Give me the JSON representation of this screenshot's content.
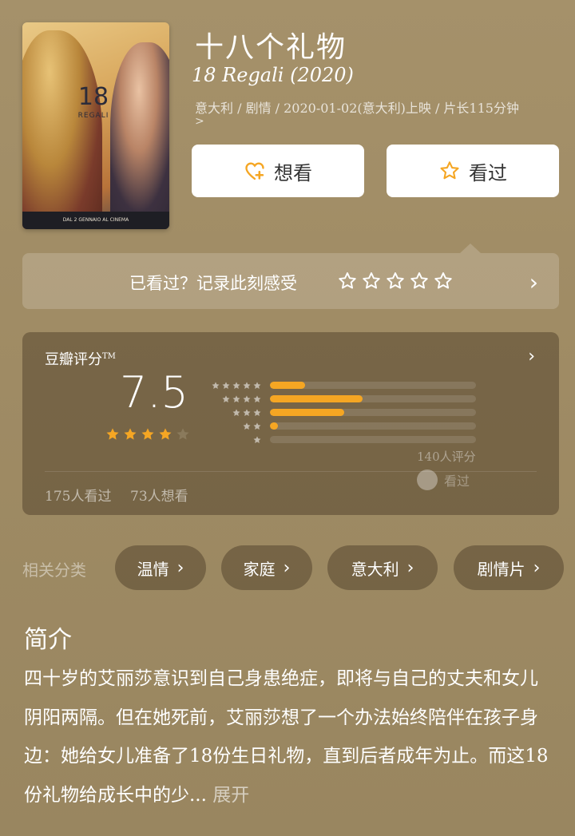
{
  "movie": {
    "title": "十八个礼物",
    "subtitle": "18 Regali (2020)",
    "meta": "意大利 / 剧情 / 2020-01-02(意大利)上映 / 片长115分钟",
    "meta_more": ">",
    "poster": {
      "title_text": "18",
      "title_word": "REGALI",
      "footer": "DAL 2 GENNAIO AL CINEMA"
    }
  },
  "actions": {
    "want_label": "想看",
    "watched_label": "看过"
  },
  "rate_prompt": {
    "question": "已看过？记录此刻感受",
    "star_count": 5
  },
  "rating": {
    "label": "豆瓣评分",
    "tm": "TM",
    "score": "7.5",
    "stars_filled": 4,
    "stars_total": 5,
    "distribution": [
      {
        "stars": 5,
        "fraction": 0.17
      },
      {
        "stars": 4,
        "fraction": 0.45
      },
      {
        "stars": 3,
        "fraction": 0.36
      },
      {
        "stars": 2,
        "fraction": 0.04
      },
      {
        "stars": 1,
        "fraction": 0.0
      }
    ],
    "count_text": "140人评分",
    "seen_text": "175人看过",
    "want_text": "73人想看",
    "watermark": "看过"
  },
  "categories": {
    "label": "相关分类",
    "items": [
      "温情",
      "家庭",
      "意大利",
      "剧情片"
    ]
  },
  "intro": {
    "title": "简介",
    "text": "四十岁的艾丽莎意识到自己身患绝症，即将与自己的丈夫和女儿阴阳两隔。但在她死前，艾丽莎想了一个办法始终陪伴在孩子身边：她给女儿准备了18份生日礼物，直到后者成年为止。而这18份礼物给成长中的少...",
    "more": "展开"
  },
  "colors": {
    "accent": "#f5a623",
    "star_empty": "#8a7a5c"
  }
}
